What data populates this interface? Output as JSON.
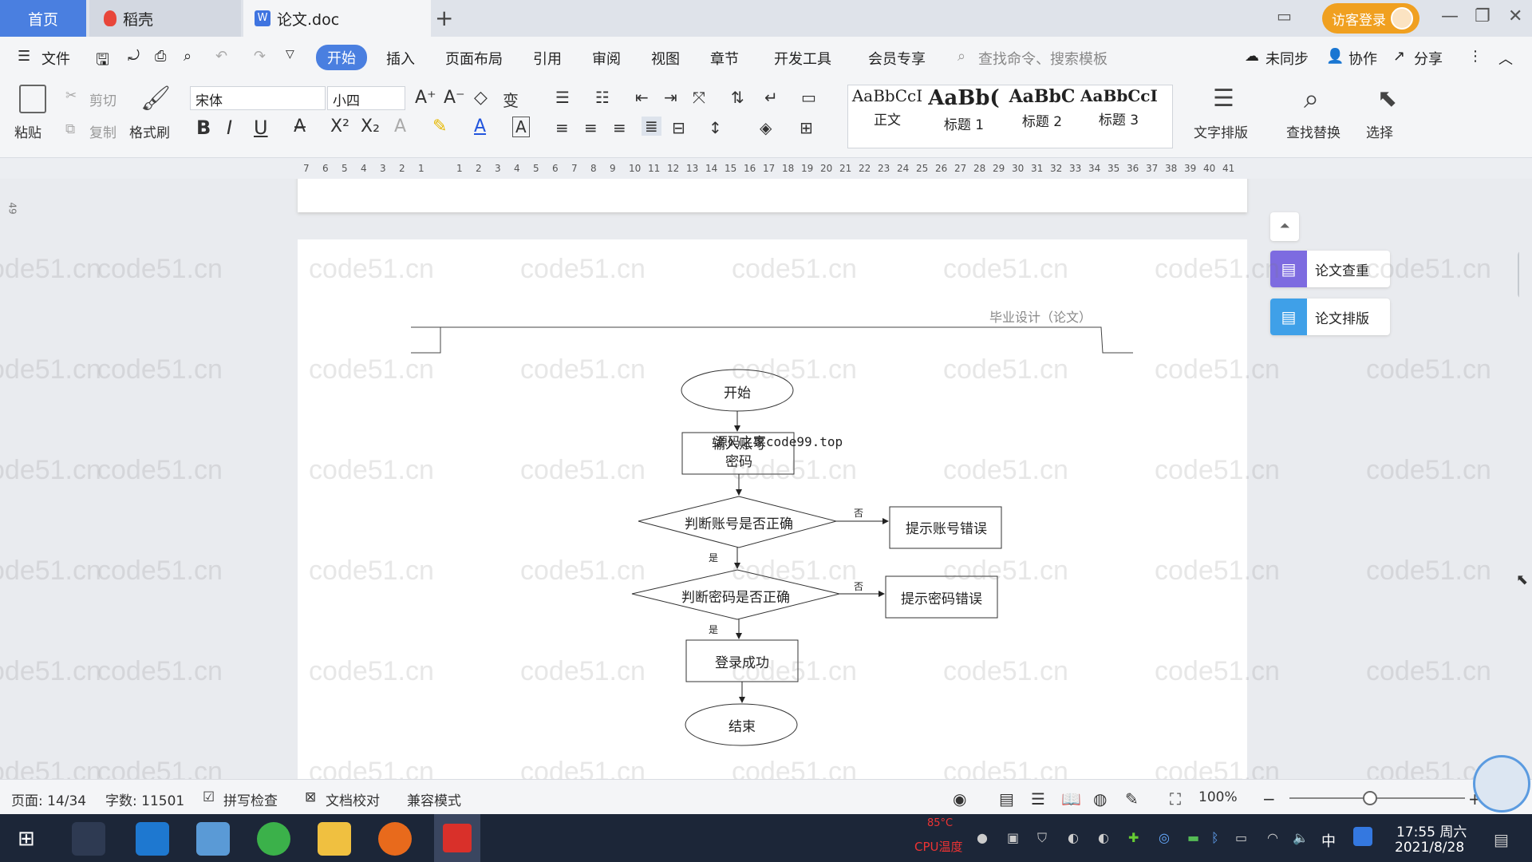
{
  "tabs": {
    "home": "首页",
    "daoke": "稻壳",
    "doc": "论文.doc",
    "new": "+"
  },
  "guest_login": "访客登录",
  "menu": {
    "file": "文件",
    "start": "开始",
    "insert": "插入",
    "layout": "页面布局",
    "ref": "引用",
    "review": "审阅",
    "view": "视图",
    "chapter": "章节",
    "dev": "开发工具",
    "vip": "会员专享",
    "search_placeholder": "查找命令、搜索模板",
    "unsync": "未同步",
    "collab": "协作",
    "share": "分享"
  },
  "toolbar": {
    "paste": "粘贴",
    "cut": "剪切",
    "copy": "复制",
    "format_painter": "格式刷",
    "font": "宋体",
    "size": "小四",
    "text_layout": "文字排版",
    "find_replace": "查找替换",
    "select": "选择"
  },
  "styles": [
    {
      "preview": "AaBbCcI",
      "label": "正文"
    },
    {
      "preview": "AaBb(",
      "label": "标题 1"
    },
    {
      "preview": "AaBbC",
      "label": "标题 2"
    },
    {
      "preview": "AaBbCcI",
      "label": "标题 3"
    }
  ],
  "ruler_ticks": [
    "7",
    "6",
    "5",
    "4",
    "3",
    "2",
    "1",
    "",
    "1",
    "2",
    "3",
    "4",
    "5",
    "6",
    "7",
    "8",
    "9",
    "10",
    "11",
    "12",
    "13",
    "14",
    "15",
    "16",
    "17",
    "18",
    "19",
    "20",
    "21",
    "22",
    "23",
    "24",
    "25",
    "26",
    "27",
    "28",
    "29",
    "30",
    "31",
    "32",
    "33",
    "34",
    "35",
    "36",
    "37",
    "38",
    "39",
    "40",
    "41"
  ],
  "doc": {
    "header": "毕业设计（论文）",
    "flow": {
      "start": "开始",
      "input": "输入账号\n密码",
      "overlay": "源码之家code99.top",
      "check_account": "判断账号是否正确",
      "account_error": "提示账号错误",
      "check_password": "判断密码是否正确",
      "password_error": "提示密码错误",
      "success": "登录成功",
      "end": "结束",
      "no": "否",
      "yes": "是"
    },
    "side_left_number": "49"
  },
  "side_panel": {
    "check": "论文查重",
    "format": "论文排版"
  },
  "watermark": "code51.cn",
  "status": {
    "page": "页面: 14/34",
    "words": "字数: 11501",
    "spell": "拼写检查",
    "proof": "文档校对",
    "compat": "兼容模式",
    "zoom": "100%"
  },
  "taskbar": {
    "cpu": "85°C",
    "cpu_label": "CPU温度",
    "ime": "中",
    "time": "17:55 周六",
    "date": "2021/8/28"
  },
  "colors": {
    "accent": "#4a7fe0",
    "guest": "#f0a020",
    "taskbar": "#1c2638"
  }
}
